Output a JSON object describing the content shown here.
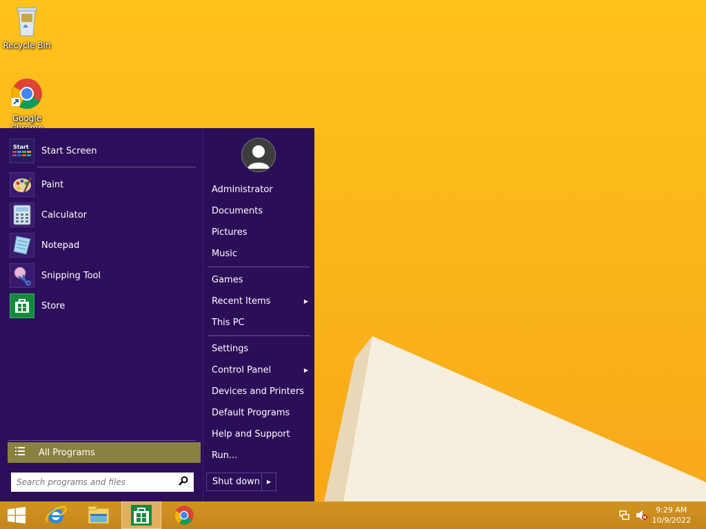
{
  "desktop": {
    "icons": [
      {
        "label": "Recycle Bin"
      },
      {
        "label": "Google Chrome"
      }
    ]
  },
  "start_menu": {
    "top_item": {
      "label": "Start Screen",
      "icon_text": "Start"
    },
    "programs": [
      {
        "label": "Paint"
      },
      {
        "label": "Calculator"
      },
      {
        "label": "Notepad"
      },
      {
        "label": "Snipping Tool"
      },
      {
        "label": "Store"
      }
    ],
    "all_programs": "All Programs",
    "search": {
      "placeholder": "Search programs and files",
      "value": ""
    },
    "right": {
      "group1": [
        "Administrator",
        "Documents",
        "Pictures",
        "Music"
      ],
      "group2": [
        "Games",
        "Recent Items",
        "This PC"
      ],
      "group3": [
        "Settings",
        "Control Panel",
        "Devices and Printers",
        "Default Programs",
        "Help and Support",
        "Run..."
      ]
    },
    "shutdown": "Shut down"
  },
  "taskbar": {
    "clock": {
      "time": "9:29 AM",
      "date": "10/9/2022"
    }
  },
  "colors": {
    "menu_bg": "#2c0e5b",
    "all_programs_bg": "#8a8040",
    "taskbar_bg": "#c98b1e"
  }
}
